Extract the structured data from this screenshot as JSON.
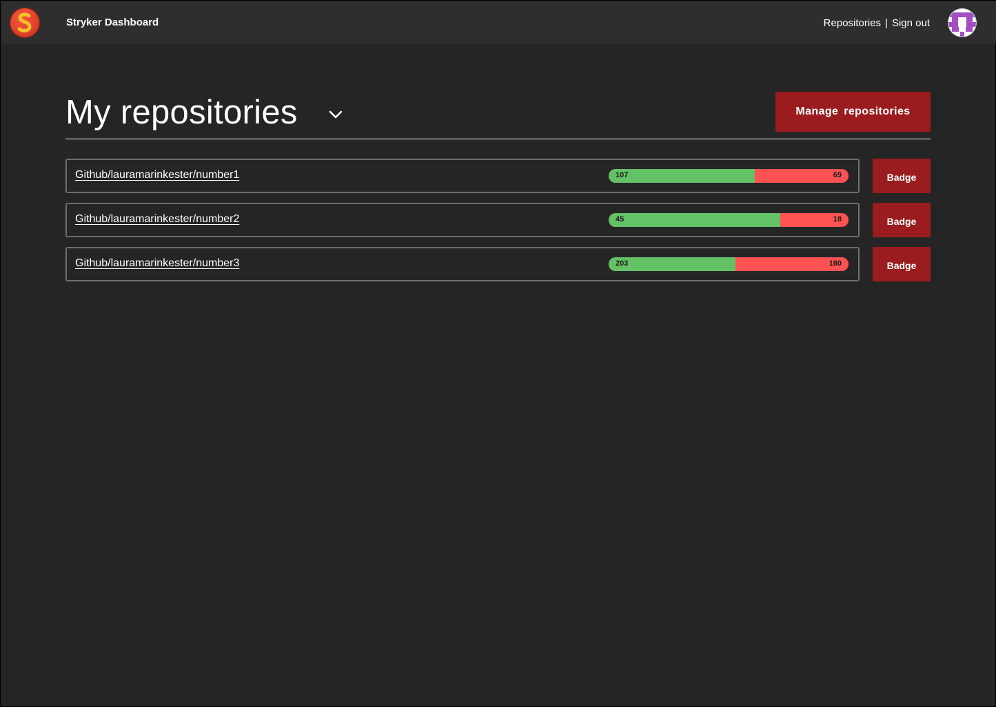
{
  "header": {
    "app_title": "Stryker Dashboard",
    "logo_icon": "stryker-s-logo-icon",
    "nav": {
      "repositories_label": "Repositories",
      "separator": "|",
      "sign_out_label": "Sign out"
    },
    "avatar_icon": "user-identicon-avatar"
  },
  "main": {
    "title": "My repositories",
    "title_dropdown_icon": "chevron-down-icon",
    "manage_button_label": "Manage  repositories",
    "repositories": [
      {
        "name": "Github/lauramarinkester/number1",
        "killed": 107,
        "survived": 69,
        "badge_label": "Badge"
      },
      {
        "name": "Github/lauramarinkester/number2",
        "killed": 45,
        "survived": 18,
        "badge_label": "Badge"
      },
      {
        "name": "Github/lauramarinkester/number3",
        "killed": 203,
        "survived": 180,
        "badge_label": "Badge"
      }
    ]
  },
  "colors": {
    "background": "#252525",
    "topbar": "#2e2e2e",
    "accent_button": "#9b1c1f",
    "score_good": "#64c266",
    "score_bad": "#ff5252"
  }
}
